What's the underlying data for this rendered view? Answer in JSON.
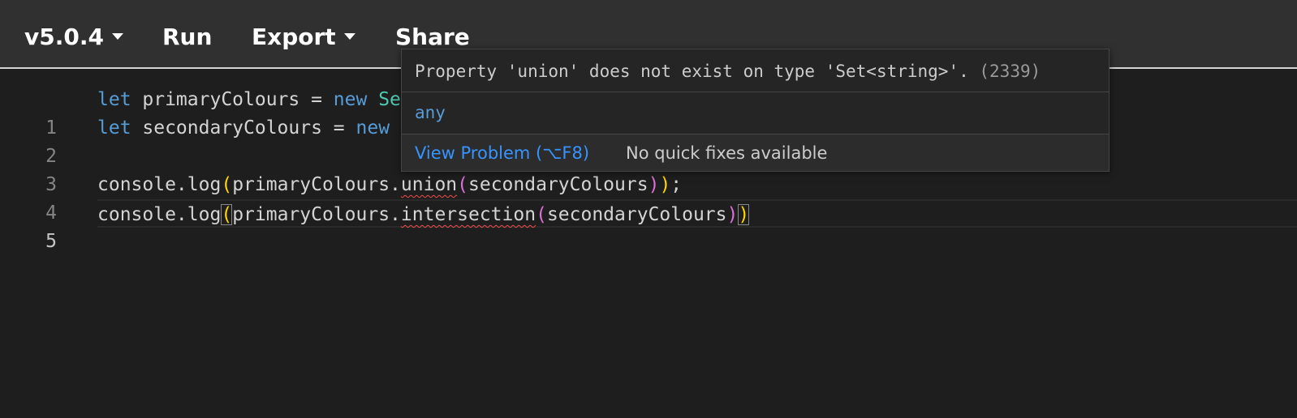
{
  "toolbar": {
    "version_label": "v5.0.4",
    "run_label": "Run",
    "export_label": "Export",
    "share_label": "Share"
  },
  "editor": {
    "lines": [
      {
        "number": "1",
        "tokens": [
          "let",
          " primaryColours = ",
          "new",
          " Se"
        ]
      },
      {
        "number": "2",
        "tokens": [
          "let",
          " secondaryColours = ",
          "new"
        ]
      },
      {
        "number": "3",
        "tokens": []
      },
      {
        "number": "4",
        "tokens": [
          "console.log",
          "(",
          "primaryColours.",
          "union",
          "(",
          "secondaryColours",
          ")",
          ")",
          ";"
        ]
      },
      {
        "number": "5",
        "tokens": [
          "console.log",
          "(",
          "primaryColours.",
          "intersection",
          "(",
          "secondaryColours",
          ")",
          ")"
        ]
      }
    ],
    "active_line": 5
  },
  "hover": {
    "message": "Property 'union' does not exist on type 'Set<string>'.",
    "error_code": "(2339)",
    "type_info": "any",
    "view_problem_label": "View Problem (⌥F8)",
    "quick_fix_label": "No quick fixes available"
  },
  "colors": {
    "keyword": "#569cd6",
    "class": "#4ec9b0",
    "bracket_level1": "#ffd700",
    "bracket_level2": "#da70d6",
    "error_squiggle": "#f14c4c",
    "link": "#3794ff"
  }
}
